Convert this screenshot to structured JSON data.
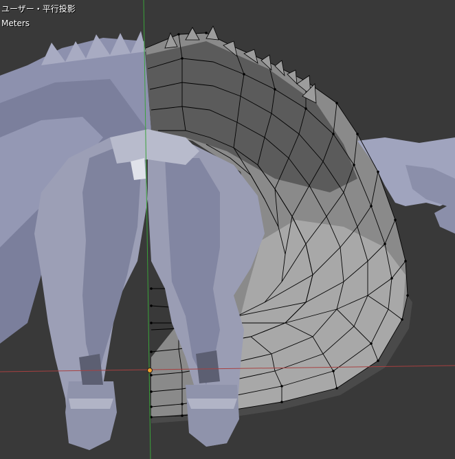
{
  "viewport": {
    "view_mode": "ユーザー・平行投影",
    "units": "Meters"
  },
  "colors": {
    "background": "#393939",
    "mesh_light": "#a6aac4",
    "mesh_mid": "#8b8fac",
    "mesh_dark": "#6b6f8c",
    "tail_surface": "#8d8d8d",
    "tail_shadow": "#4f4f4f",
    "wire": "#000000",
    "x_axis": "#a84040",
    "y_axis": "#3aa33a",
    "origin": "#f0a030"
  },
  "icons": {
    "origin": "object-origin-icon"
  }
}
